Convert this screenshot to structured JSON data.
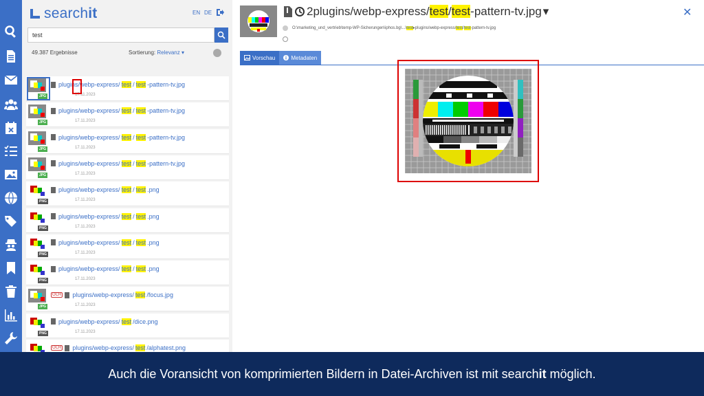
{
  "brand": {
    "logo_prefix": "search",
    "logo_bold": "it"
  },
  "lang": {
    "en": "EN",
    "de": "DE"
  },
  "search": {
    "value": "test"
  },
  "results_meta": {
    "count": "49.387 Ergebnisse",
    "sort_label": "Sortierung:",
    "sort_value": "Relevanz"
  },
  "results": [
    {
      "pre": "plugins/webp-express/",
      "h1": "test",
      "mid": "/",
      "h2": "test",
      "post": "-pattern-tv.jpg",
      "date": "17.11.2023",
      "type": "JPG",
      "ocr": ""
    },
    {
      "pre": "plugins/webp-express/",
      "h1": "test",
      "mid": "/",
      "h2": "test",
      "post": "-pattern-tv.jpg",
      "date": "17.11.2023",
      "type": "JPG",
      "ocr": ""
    },
    {
      "pre": "plugins/webp-express/",
      "h1": "test",
      "mid": "/",
      "h2": "test",
      "post": "-pattern-tv.jpg",
      "date": "17.11.2023",
      "type": "JPG",
      "ocr": ""
    },
    {
      "pre": "plugins/webp-express/",
      "h1": "test",
      "mid": "/",
      "h2": "test",
      "post": "-pattern-tv.jpg",
      "date": "17.11.2023",
      "type": "JPG",
      "ocr": ""
    },
    {
      "pre": "plugins/webp-express/",
      "h1": "test",
      "mid": "/",
      "h2": "test",
      "post": ".png",
      "date": "17.11.2023",
      "type": "PNG",
      "ocr": ""
    },
    {
      "pre": "plugins/webp-express/",
      "h1": "test",
      "mid": "/",
      "h2": "test",
      "post": ".png",
      "date": "17.11.2023",
      "type": "PNG",
      "ocr": ""
    },
    {
      "pre": "plugins/webp-express/",
      "h1": "test",
      "mid": "/",
      "h2": "test",
      "post": ".png",
      "date": "17.11.2023",
      "type": "PNG",
      "ocr": ""
    },
    {
      "pre": "plugins/webp-express/",
      "h1": "test",
      "mid": "/",
      "h2": "test",
      "post": ".png",
      "date": "17.11.2023",
      "type": "PNG",
      "ocr": ""
    },
    {
      "pre": "plugins/webp-express/",
      "h1": "test",
      "mid": "/focus.jpg",
      "h2": "",
      "post": "",
      "date": "17.11.2023",
      "type": "JPG",
      "ocr": "OCR"
    },
    {
      "pre": "plugins/webp-express/",
      "h1": "test",
      "mid": "/dice.png",
      "h2": "",
      "post": "",
      "date": "17.11.2023",
      "type": "PNG",
      "ocr": ""
    },
    {
      "pre": "plugins/webp-express/",
      "h1": "test",
      "mid": "/alphatest.png",
      "h2": "",
      "post": "",
      "date": "",
      "type": "PNG",
      "ocr": "OCR"
    }
  ],
  "detail": {
    "title_pre": "2plugins/webp-express/",
    "title_h1": "test",
    "title_mid": "/",
    "title_h2": "test",
    "title_post": "-pattern-tv.jpg",
    "path_pre": "O:\\marketing_und_vertrieb\\temp-WP-Sicherungen\\iphos.bg\\...\\",
    "path_h1": "test",
    "path_mid": "▸plugins/webp-express/",
    "path_h2": "test",
    "path_mid2": "/",
    "path_h3": "test",
    "path_post": "-pattern-tv.jpg",
    "tab_preview": "Vorschau",
    "tab_metadata": "Metadaten"
  },
  "caption": {
    "pre": "Auch die Voransicht von komprimierten Bildern in Datei-Archiven ist  mit search",
    "bold": "it",
    "post": " möglich."
  },
  "colors": {
    "accent": "#3b6fc6",
    "highlight": "#fff200",
    "caption_bg": "#0e2a5c",
    "marker": "#dd0000"
  }
}
